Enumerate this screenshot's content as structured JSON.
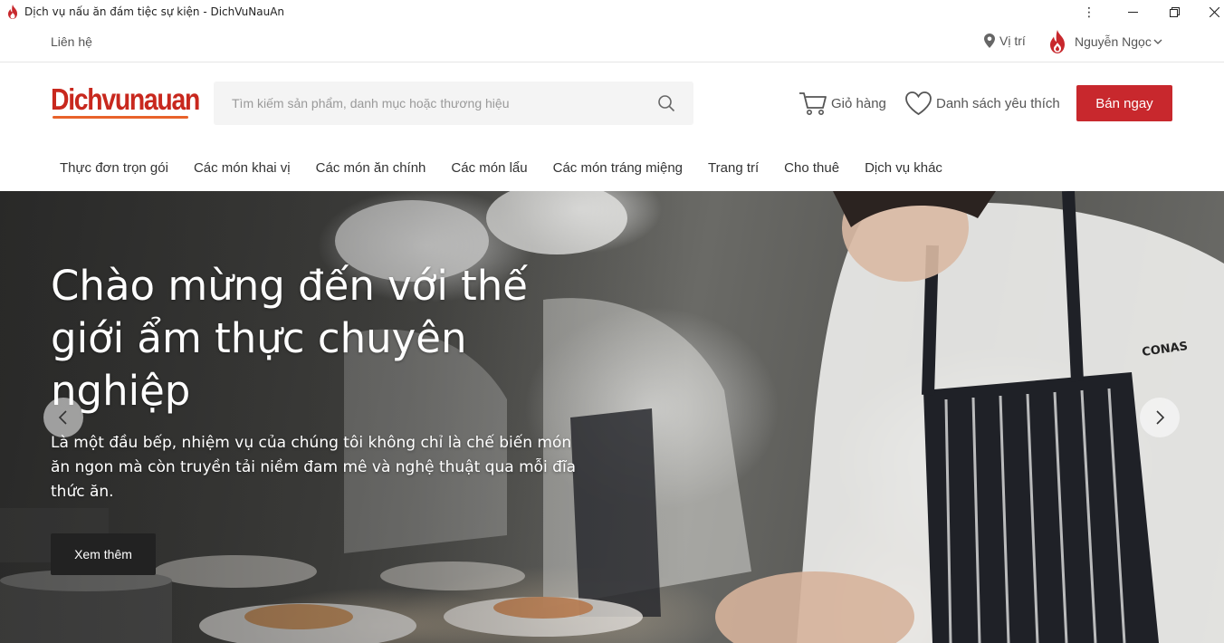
{
  "window": {
    "title": "Dịch vụ nấu ăn đám tiệc sự kiện - DichVuNauAn",
    "icon": "flame-icon",
    "controls": {
      "more": "⋮",
      "minimize": "—",
      "maximize": "❐",
      "close": "✕"
    }
  },
  "topbar": {
    "contact": "Liên hệ",
    "location": "Vị trí",
    "user_name": "Nguyễn Ngọc"
  },
  "header": {
    "logo_text": "Dichvunauan",
    "search_placeholder": "Tìm kiếm sản phẩm, danh mục hoặc thương hiệu",
    "cart_label": "Giỏ hàng",
    "wishlist_label": "Danh sách yêu thích",
    "sell_button": "Bán ngay"
  },
  "categories": [
    "Thực đơn trọn gói",
    "Các món khai vị",
    "Các món ăn chính",
    "Các món lẩu",
    "Các món tráng miệng",
    "Trang trí",
    "Cho thuê",
    "Dịch vụ khác"
  ],
  "hero": {
    "title": "Chào mừng đến với thế giới ẩm thực chuyên nghiệp",
    "description": "Là một đầu bếp, nhiệm vụ của chúng tôi không chỉ là chế biến món ăn ngon mà còn truyền tải niềm đam mê và nghệ thuật qua mỗi đĩa thức ăn.",
    "button": "Xem thêm",
    "apron_text": "CONAS"
  },
  "colors": {
    "brand_red": "#c8282d",
    "logo_orange": "#e8622a",
    "dark_button": "#222222"
  }
}
